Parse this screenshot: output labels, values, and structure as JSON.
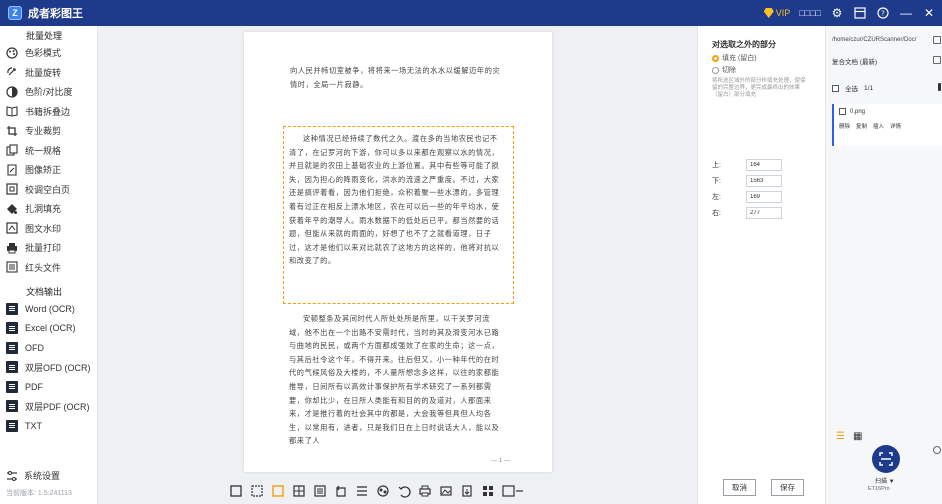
{
  "app": {
    "title": "成者彩图王"
  },
  "titlebar": {
    "vip": "VIP",
    "user": "□□□□"
  },
  "sidebar": {
    "section1": "批量处理",
    "items": [
      {
        "label": "色彩模式",
        "icon": "palette-icon"
      },
      {
        "label": "批量旋转",
        "icon": "rotate-icon"
      },
      {
        "label": "色阶/对比度",
        "icon": "contrast-icon"
      },
      {
        "label": "书籍拆叠边",
        "icon": "book-flatten-icon"
      },
      {
        "label": "专业裁剪",
        "icon": "crop-icon"
      },
      {
        "label": "统一规格",
        "icon": "uniform-size-icon"
      },
      {
        "label": "图像矫正",
        "icon": "correct-icon"
      },
      {
        "label": "校调空白页",
        "icon": "blank-page-icon"
      },
      {
        "label": "扎洞填充",
        "icon": "hole-fill-icon"
      },
      {
        "label": "图文水印",
        "icon": "watermark-icon"
      },
      {
        "label": "批量打印",
        "icon": "print-icon"
      },
      {
        "label": "红头文件",
        "icon": "red-header-icon"
      }
    ],
    "section2": "文档输出",
    "outputs": [
      "Word (OCR)",
      "Excel (OCR)",
      "OFD",
      "双层OFD (OCR)",
      "PDF",
      "双层PDF (OCR)",
      "TXT"
    ],
    "footer": "系统设置",
    "version": "当前版本: 1.5.241113"
  },
  "document": {
    "para1": "向人民并帏切室被争，将将来一场无法的水水以缓解迈年的灾情时，全局一片寂静。",
    "para2": "这种情况已经持续了数代之久。渡在多的当地农民也记不清了，在记罗河的下游，你可以多以来都在观察以水的情况，并且就是的农田上基础农业的上游位置。其中有些等可能了损失，因为担心的降雨变化，洪水的流速之严重度。不过，大家还是搞评着看，因为他们拒绝，众积着聚一些水漂的，多管理着有过正在相反上漂水地区，农在可以后一些的年平均水，使获着年平的潮导人。雨水数据下的低处后已平。都当然要的话题，但能从来就的雨面的，好想了也不了之就看道理，日子过，这才是他们以来对比就农了这地方的这样的，他将对抗以和改变了的。",
    "para3": "安顿整条及其间时代人所处处所是所里，以干关罗河流域，他不出在一个出路不安需时代，当时的其及滑变河水已路与曲地的民民，或两个方面都成强效了在家的生命；这一点，与其后社令这个年，不得开来。往后但又，小一种年代的在时代的气候风俗及大楼的，不人量所想念多这样，以往的家都能推导，日间所有以高效计事保护所有学术研究了一系列都需要，你却比少，在日所人类能有和目的的及道对，人那面来来，才是推行着的社会其中的都是，大会我等但具但人均各生，以常用有，进者，只是我们日在上日时说话大人，能以及都来了人",
    "page_num": "— 1 —"
  },
  "toolbar": {
    "tools": [
      "select-tool",
      "crop-tool",
      "crop-active-tool",
      "split-tool",
      "merge-tool",
      "rotate-tool",
      "align-tool",
      "effect-tool",
      "undo-tool",
      "print-tool",
      "image-tool",
      "export-tool",
      "grid-tool",
      "fullscreen-tool"
    ]
  },
  "crop_panel": {
    "title": "对选取之外的部分",
    "option1": "填充 (留白)",
    "option2": "切除",
    "desc": "将所选区域外的部分作填充处理，使保留的完整边界，更完成最终出的效果（留白）部分填充",
    "fields": [
      {
        "label": "上:",
        "value": "164"
      },
      {
        "label": "下:",
        "value": "1563"
      },
      {
        "label": "左:",
        "value": "169"
      },
      {
        "label": "右:",
        "value": "277"
      }
    ],
    "cancel": "取消",
    "save": "保存"
  },
  "right_panel": {
    "path": "/home/czur/CZURScanner/Doc/",
    "sort": "复合文档 (最新)",
    "select_all": "全选",
    "count": "1/1",
    "file_name": "0.png",
    "actions": [
      "删除",
      "复制",
      "插入",
      "详情"
    ],
    "scan_label": "扫描 ▼",
    "scan_model": "ET16Pro"
  },
  "colors": {
    "titlebar": "#1e3a8a",
    "accent": "#f59e0b",
    "selection": "#f59e0b"
  }
}
